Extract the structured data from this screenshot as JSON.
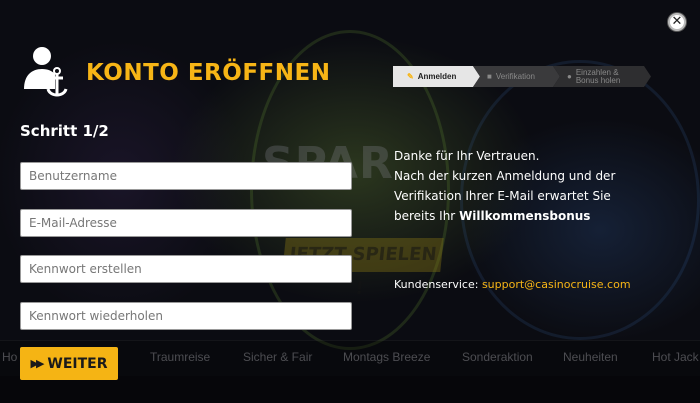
{
  "modal": {
    "title": "KONTO ERÖFFNEN",
    "step_label": "Schritt 1/2",
    "steps": [
      {
        "label": "Anmelden",
        "icon": "pencil-icon",
        "active": true
      },
      {
        "label": "Verifikation",
        "icon": "lock-icon",
        "active": false
      },
      {
        "label_line1": "Einzahlen &",
        "label_line2": "Bonus holen",
        "icon": "coins-icon",
        "active": false
      }
    ],
    "fields": {
      "username_placeholder": "Benutzername",
      "email_placeholder": "E-Mail-Adresse",
      "password_placeholder": "Kennwort erstellen",
      "password_repeat_placeholder": "Kennwort wiederholen"
    },
    "submit_label": "WEITER",
    "info": {
      "line1": "Danke für Ihr Vertrauen.",
      "line2": "Nach der kurzen Anmeldung und der",
      "line3": "Verifikation Ihrer E-Mail erwartet Sie",
      "line4_prefix": "bereits Ihr ",
      "line4_bold": "Willkommensbonus"
    },
    "support_label": "Kundenservice:",
    "support_email": "support@casinocruise.com"
  },
  "background": {
    "promo_title": "SPAR",
    "promo_button": "JETZT SPIELEN !",
    "nav": [
      "Ho",
      "Traumreise",
      "Sicher & Fair",
      "Montags Breeze",
      "Sonderaktion",
      "Neuheiten",
      "Hot Jack"
    ]
  },
  "colors": {
    "accent": "#f7b516",
    "overlay": "#0b0c12"
  }
}
